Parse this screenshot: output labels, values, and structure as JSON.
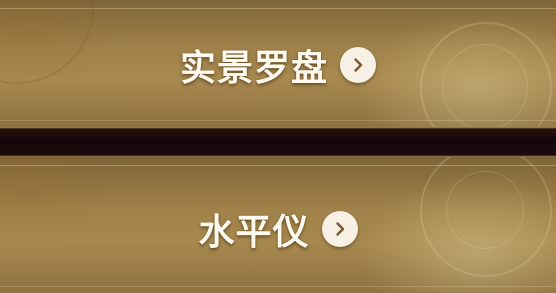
{
  "menu": {
    "items": [
      {
        "label": "实景罗盘",
        "icon": "chevron-right-icon"
      },
      {
        "label": "水平仪",
        "icon": "chevron-right-icon"
      }
    ]
  },
  "colors": {
    "card_gold": "#a8894f",
    "divider_dark": "#14060a",
    "label_text": "#fffaf0",
    "arrow_bg": "#f6f1e4",
    "arrow_stroke": "#7a5a2e"
  }
}
